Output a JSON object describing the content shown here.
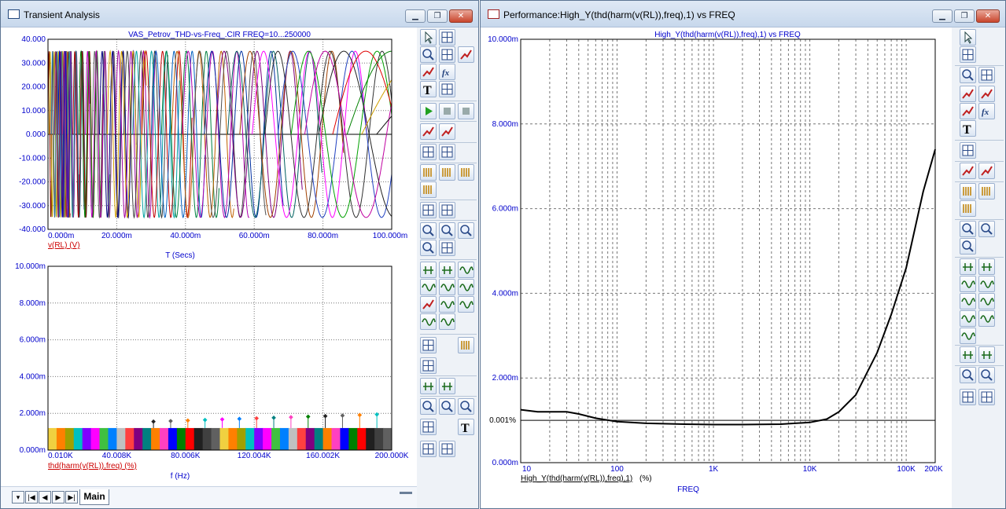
{
  "window_left": {
    "title": "Transient Analysis",
    "plot_top": {
      "title": "VAS_Petrov_THD-vs-Freq_.CIR FREQ=10...250000",
      "y_ticks": [
        "40.000",
        "30.000",
        "20.000",
        "10.000",
        "0.000",
        "-10.000",
        "-20.000",
        "-30.000",
        "-40.000"
      ],
      "x_ticks": [
        "0.000m",
        "20.000m",
        "40.000m",
        "60.000m",
        "80.000m",
        "100.000m"
      ],
      "trace_label": "v(RL) (V)",
      "x_label": "T (Secs)"
    },
    "plot_bottom": {
      "y_ticks": [
        "10.000m",
        "8.000m",
        "6.000m",
        "4.000m",
        "2.000m",
        "0.000m"
      ],
      "x_ticks": [
        "0.010K",
        "40.008K",
        "80.006K",
        "120.004K",
        "160.002K",
        "200.000K"
      ],
      "trace_label": "thd(harm(v(RL)),freq) (%)",
      "x_label": "f (Hz)"
    },
    "nav_buttons": [
      "▾",
      "|◀",
      "◀",
      "▶",
      "▶|"
    ],
    "tab_label": "Main"
  },
  "window_right": {
    "title": "Performance:High_Y(thd(harm(v(RL)),freq),1) vs FREQ",
    "plot_title": "High_Y(thd(harm(v(RL)),freq),1) vs FREQ",
    "y_ticks": [
      "10.000m",
      "8.000m",
      "6.000m",
      "4.000m",
      "2.000m",
      "0.000m"
    ],
    "x_ticks": [
      "10",
      "100",
      "1K",
      "10K",
      "100K",
      "200K"
    ],
    "marker_label": "0.001%",
    "trace_label": "High_Y(thd(harm(v(RL)),freq),1)",
    "trace_unit": "(%)",
    "x_label": "FREQ"
  },
  "caption_buttons": {
    "minimize": "▁",
    "restore": "❐",
    "close": "✕"
  },
  "colors": {
    "tick_text": "#0000cc",
    "trace_label": "#cc0000",
    "curve": "#000000",
    "grid": "#777777"
  },
  "chart_data": [
    {
      "type": "line",
      "title": "VAS_Petrov_THD-vs-Freq_.CIR FREQ=10...250000",
      "xlabel": "T (Secs)",
      "ylabel": "v(RL) (V)",
      "xlim": [
        0,
        0.1
      ],
      "ylim": [
        -40,
        40
      ],
      "amplitude": 35,
      "series_frequencies_hz": [
        900,
        820,
        750,
        680,
        620,
        560,
        510,
        470,
        430,
        395,
        360,
        330,
        300,
        275,
        250,
        228,
        208,
        190,
        172,
        156,
        142,
        128,
        116,
        104,
        94,
        84,
        75,
        66,
        58,
        50,
        42,
        34,
        26,
        19,
        13,
        8
      ],
      "grid": true
    },
    {
      "type": "bar",
      "xlabel": "f (Hz)",
      "ylabel": "thd(harm(v(RL)),freq) (%)",
      "xlim": [
        10,
        200000
      ],
      "ylim": [
        0,
        0.01
      ],
      "baseline_value": 0.0012,
      "grid": true
    },
    {
      "type": "line",
      "title": "High_Y(thd(harm(v(RL)),freq),1) vs FREQ",
      "xlabel": "FREQ",
      "ylabel": "High_Y(thd(harm(v(RL)),freq),1) (%)",
      "x_scale": "log",
      "xlim": [
        10,
        200000
      ],
      "ylim": [
        0,
        0.01
      ],
      "x": [
        10,
        15,
        20,
        30,
        40,
        60,
        100,
        200,
        500,
        1000,
        2000,
        5000,
        10000,
        15000,
        20000,
        30000,
        50000,
        70000,
        100000,
        150000,
        200000
      ],
      "y": [
        0.00125,
        0.0012,
        0.0012,
        0.0012,
        0.00115,
        0.00105,
        0.00097,
        0.00093,
        0.00091,
        0.0009,
        0.0009,
        0.00091,
        0.00095,
        0.00103,
        0.0012,
        0.0016,
        0.0026,
        0.0035,
        0.0046,
        0.0064,
        0.0074
      ],
      "marker_y": 0.001,
      "grid": true
    }
  ]
}
